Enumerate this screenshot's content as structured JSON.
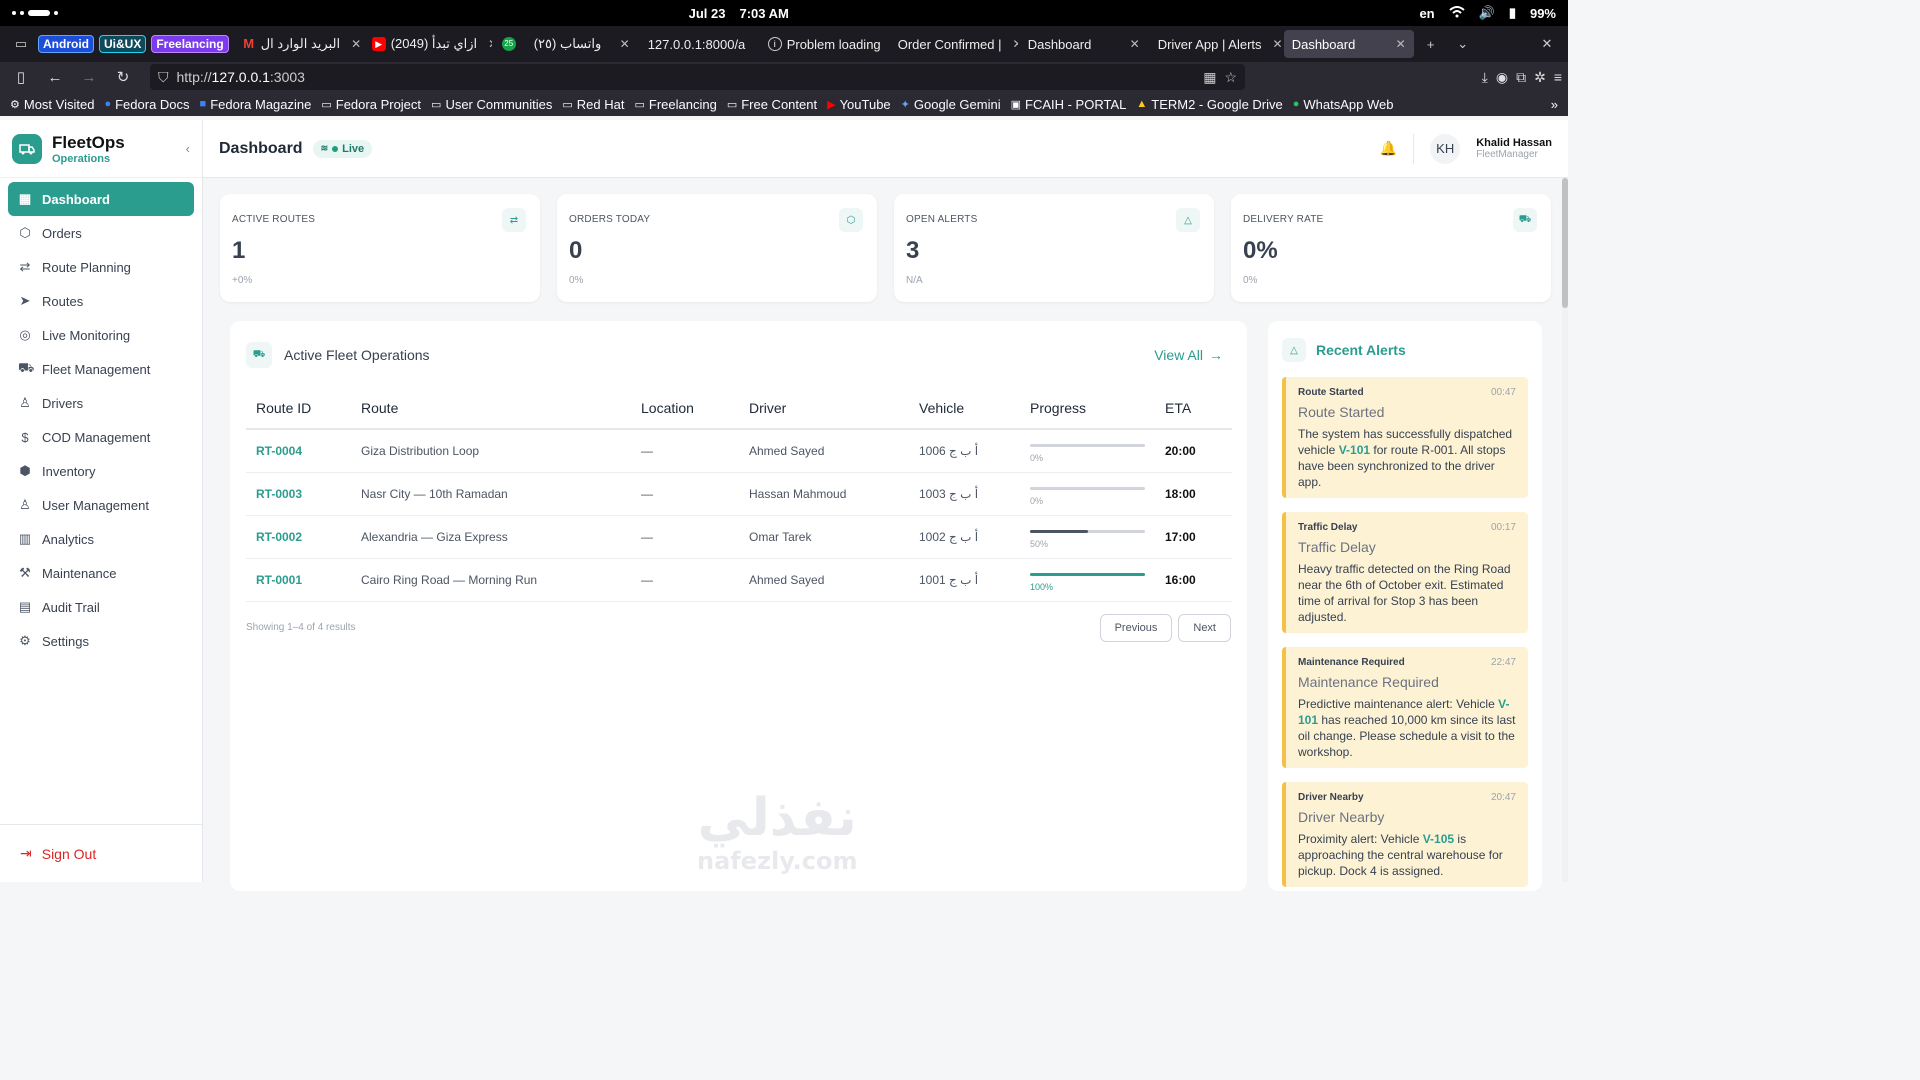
{
  "os": {
    "date": "Jul 23",
    "time": "7:03 AM",
    "lang": "en",
    "battery": "99%"
  },
  "browser": {
    "groups": [
      "Android",
      "Ui&UX",
      "Freelancing"
    ],
    "tabs": [
      {
        "title": "البريد الوارد ال",
        "fav": "M"
      },
      {
        "title": "(2049) ازاي تبدأ",
        "fav": "▶"
      },
      {
        "title": "25",
        "fav": "25"
      },
      {
        "title": "(٢٥) واتساب",
        "fav": ""
      },
      {
        "title": "127.0.0.1:8000/a",
        "fav": ""
      },
      {
        "title": "Problem loading",
        "fav": "i"
      },
      {
        "title": "Order Confirmed |",
        "fav": ""
      },
      {
        "title": "Dashboard",
        "fav": ""
      },
      {
        "title": "Driver App | Alerts",
        "fav": ""
      },
      {
        "title": "Dashboard",
        "fav": ""
      }
    ],
    "url_prefix": "http://",
    "url_host": "127.0.0.1",
    "url_port": ":3003",
    "bookmarks": [
      "Most Visited",
      "Fedora Docs",
      "Fedora Magazine",
      "Fedora Project",
      "User Communities",
      "Red Hat",
      "Freelancing",
      "Free Content",
      "YouTube",
      "Google Gemini",
      "FCAIH - PORTAL",
      "TERM2 - Google Drive",
      "WhatsApp Web"
    ]
  },
  "brand": {
    "name": "FleetOps",
    "sub": "Operations"
  },
  "menu": [
    "Dashboard",
    "Orders",
    "Route Planning",
    "Routes",
    "Live Monitoring",
    "Fleet Management",
    "Drivers",
    "COD Management",
    "Inventory",
    "User Management",
    "Analytics",
    "Maintenance",
    "Audit Trail",
    "Settings"
  ],
  "signout": "Sign Out",
  "header": {
    "title": "Dashboard",
    "live": "Live",
    "initials": "KH",
    "user": "Khalid Hassan",
    "role": "FleetManager"
  },
  "stats": [
    {
      "label": "ACTIVE ROUTES",
      "value": "1",
      "sub": "+0%"
    },
    {
      "label": "ORDERS TODAY",
      "value": "0",
      "sub": "0%"
    },
    {
      "label": "OPEN ALERTS",
      "value": "3",
      "sub": "N/A"
    },
    {
      "label": "DELIVERY RATE",
      "value": "0%",
      "sub": "0%"
    }
  ],
  "fleet": {
    "title": "Active Fleet Operations",
    "view_all": "View All",
    "columns": [
      "Route ID",
      "Route",
      "Location",
      "Driver",
      "Vehicle",
      "Progress",
      "ETA"
    ],
    "rows": [
      {
        "id": "RT-0004",
        "route": "Giza Distribution Loop",
        "location": "—",
        "driver": "Ahmed Sayed",
        "vehicle": "أ ب ج 1006",
        "progress": 0,
        "progress_label": "0%",
        "eta": "20:00"
      },
      {
        "id": "RT-0003",
        "route": "Nasr City — 10th Ramadan",
        "location": "—",
        "driver": "Hassan Mahmoud",
        "vehicle": "أ ب ج 1003",
        "progress": 0,
        "progress_label": "0%",
        "eta": "18:00"
      },
      {
        "id": "RT-0002",
        "route": "Alexandria — Giza Express",
        "location": "—",
        "driver": "Omar Tarek",
        "vehicle": "أ ب ج 1002",
        "progress": 50,
        "progress_label": "50%",
        "eta": "17:00"
      },
      {
        "id": "RT-0001",
        "route": "Cairo Ring Road — Morning Run",
        "location": "—",
        "driver": "Ahmed Sayed",
        "vehicle": "أ ب ج 1001",
        "progress": 100,
        "progress_label": "100%",
        "eta": "16:00"
      }
    ],
    "showing": "Showing 1–4 of 4 results",
    "prev": "Previous",
    "next": "Next"
  },
  "watermark": {
    "ar": "نفذلي",
    "en": "nafezly.com"
  },
  "alerts": {
    "title": "Recent Alerts",
    "items": [
      {
        "type": "Route Started",
        "time": "00:47",
        "name": "Route Started",
        "pre": "The system has successfully dispatched vehicle ",
        "vehicle": "V-101",
        "post": " for route R-001. All stops have been synchronized to the driver app."
      },
      {
        "type": "Traffic Delay",
        "time": "00:17",
        "name": "Traffic Delay",
        "pre": "Heavy traffic detected on the Ring Road near the 6th of October exit. Estimated time of arrival for Stop 3 has been adjusted.",
        "vehicle": "",
        "post": ""
      },
      {
        "type": "Maintenance Required",
        "time": "22:47",
        "name": "Maintenance Required",
        "pre": "Predictive maintenance alert: Vehicle ",
        "vehicle": "V-101",
        "post": " has reached 10,000 km since its last oil change. Please schedule a visit to the workshop."
      },
      {
        "type": "Driver Nearby",
        "time": "20:47",
        "name": "Driver Nearby",
        "pre": "Proximity alert: Vehicle ",
        "vehicle": "V-105",
        "post": " is approaching the central warehouse for pickup. Dock 4 is assigned."
      }
    ]
  },
  "colors": {
    "accent": "#2a9d8f",
    "alert_bg": "#fdf3d4",
    "alert_border": "#f3c04a",
    "progress_mid": "#4b5563"
  }
}
